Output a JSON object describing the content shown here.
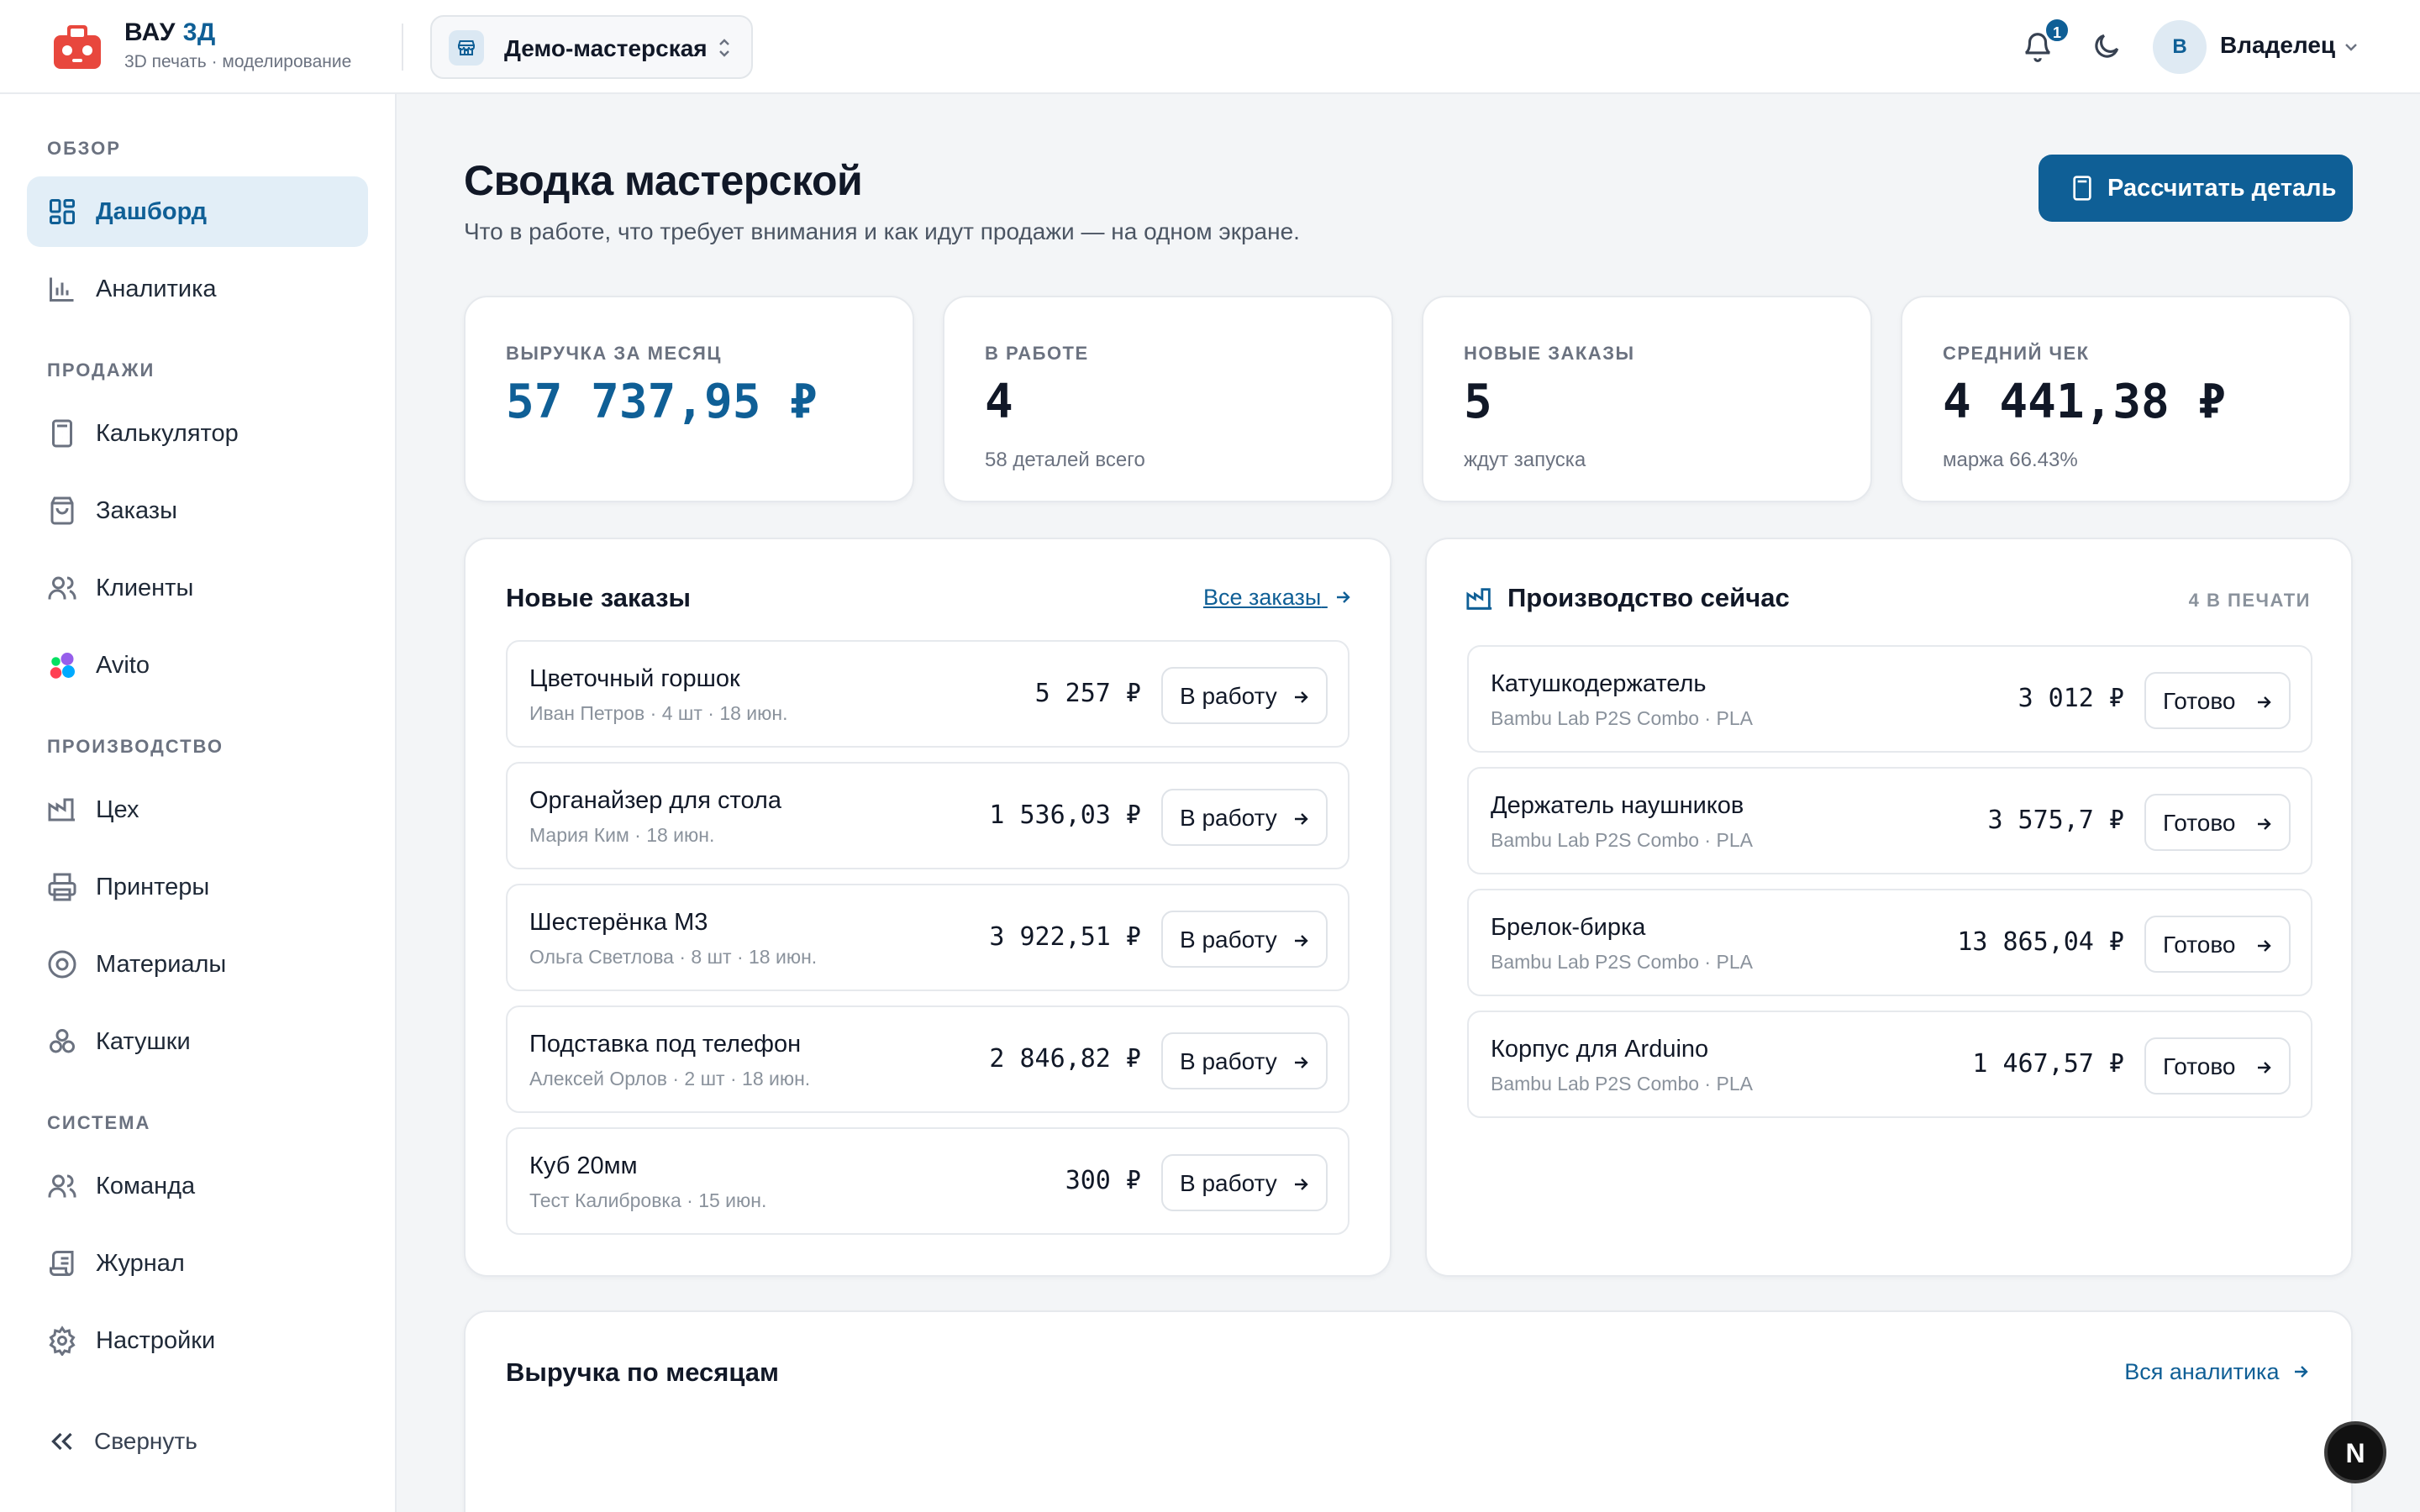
{
  "app": {
    "brand_main": "ВАУ ",
    "brand_accent": "3Д",
    "brand_sub": "3D печать · моделирование",
    "workspace": "Демо-мастерская",
    "notifications_count": "1",
    "avatar_initial": "В",
    "user_name": "Владелец"
  },
  "sidebar": {
    "sections": [
      {
        "title": "ОБЗОР",
        "items": [
          {
            "label": "Дашборд",
            "icon": "dashboard-icon",
            "active": true
          },
          {
            "label": "Аналитика",
            "icon": "bar-chart-icon"
          }
        ]
      },
      {
        "title": "ПРОДАЖИ",
        "items": [
          {
            "label": "Калькулятор",
            "icon": "calculator-icon"
          },
          {
            "label": "Заказы",
            "icon": "shopping-bag-icon"
          },
          {
            "label": "Клиенты",
            "icon": "users-icon"
          },
          {
            "label": "Avito",
            "icon": "avito-logo-icon"
          }
        ]
      },
      {
        "title": "ПРОИЗВОДСТВО",
        "items": [
          {
            "label": "Цех",
            "icon": "factory-icon"
          },
          {
            "label": "Принтеры",
            "icon": "printer-icon"
          },
          {
            "label": "Материалы",
            "icon": "material-icon"
          },
          {
            "label": "Катушки",
            "icon": "spool-icon"
          }
        ]
      },
      {
        "title": "СИСТЕМА",
        "items": [
          {
            "label": "Команда",
            "icon": "team-icon"
          },
          {
            "label": "Журнал",
            "icon": "log-icon"
          },
          {
            "label": "Настройки",
            "icon": "gear-icon"
          }
        ]
      }
    ],
    "collapse_label": "Свернуть"
  },
  "main": {
    "title": "Сводка мастерской",
    "subtitle": "Что в работе, что требует внимания и как идут продажи — на одном экране.",
    "calc_button": "Рассчитать деталь"
  },
  "stats": [
    {
      "label": "ВЫРУЧКА ЗА МЕСЯЦ",
      "value": "57 737,95 ₽",
      "sub": ""
    },
    {
      "label": "В РАБОТЕ",
      "value": "4",
      "sub": "58 деталей всего"
    },
    {
      "label": "НОВЫЕ ЗАКАЗЫ",
      "value": "5",
      "sub": "ждут запуска"
    },
    {
      "label": "СРЕДНИЙ ЧЕК",
      "value": "4 441,38 ₽",
      "sub": "маржа 66.43%"
    }
  ],
  "new_orders": {
    "title": "Новые заказы",
    "link": "Все заказы",
    "action": "В работу",
    "items": [
      {
        "name": "Цветочный горшок",
        "meta": "Иван Петров · 4 шт · 18 июн.",
        "price": "5 257 ₽"
      },
      {
        "name": "Органайзер для стола",
        "meta": "Мария Ким · 18 июн.",
        "price": "1 536,03 ₽"
      },
      {
        "name": "Шестерёнка М3",
        "meta": "Ольга Светлова · 8 шт · 18 июн.",
        "price": "3 922,51 ₽"
      },
      {
        "name": "Подставка под телефон",
        "meta": "Алексей Орлов · 2 шт · 18 июн.",
        "price": "2 846,82 ₽"
      },
      {
        "name": "Куб 20мм",
        "meta": "Тест Калибровка · 15 июн.",
        "price": "300 ₽"
      }
    ]
  },
  "production": {
    "title": "Производство сейчас",
    "count_label": "4 В ПЕЧАТИ",
    "action": "Готово",
    "items": [
      {
        "name": "Катушкодержатель",
        "meta": "Bambu Lab P2S Combo · PLA",
        "price": "3 012 ₽"
      },
      {
        "name": "Держатель наушников",
        "meta": "Bambu Lab P2S Combo · PLA",
        "price": "3 575,7 ₽"
      },
      {
        "name": "Брелок-бирка",
        "meta": "Bambu Lab P2S Combo · PLA",
        "price": "13 865,04 ₽"
      },
      {
        "name": "Корпус для Arduino",
        "meta": "Bambu Lab P2S Combo · PLA",
        "price": "1 467,57 ₽"
      }
    ]
  },
  "revenue": {
    "title": "Выручка по месяцам",
    "link": "Вся аналитика"
  },
  "fab_label": "N",
  "colors": {
    "accent": "#0f5f96",
    "active_bg": "#e2eef7",
    "logo_red": "#e8473d"
  }
}
